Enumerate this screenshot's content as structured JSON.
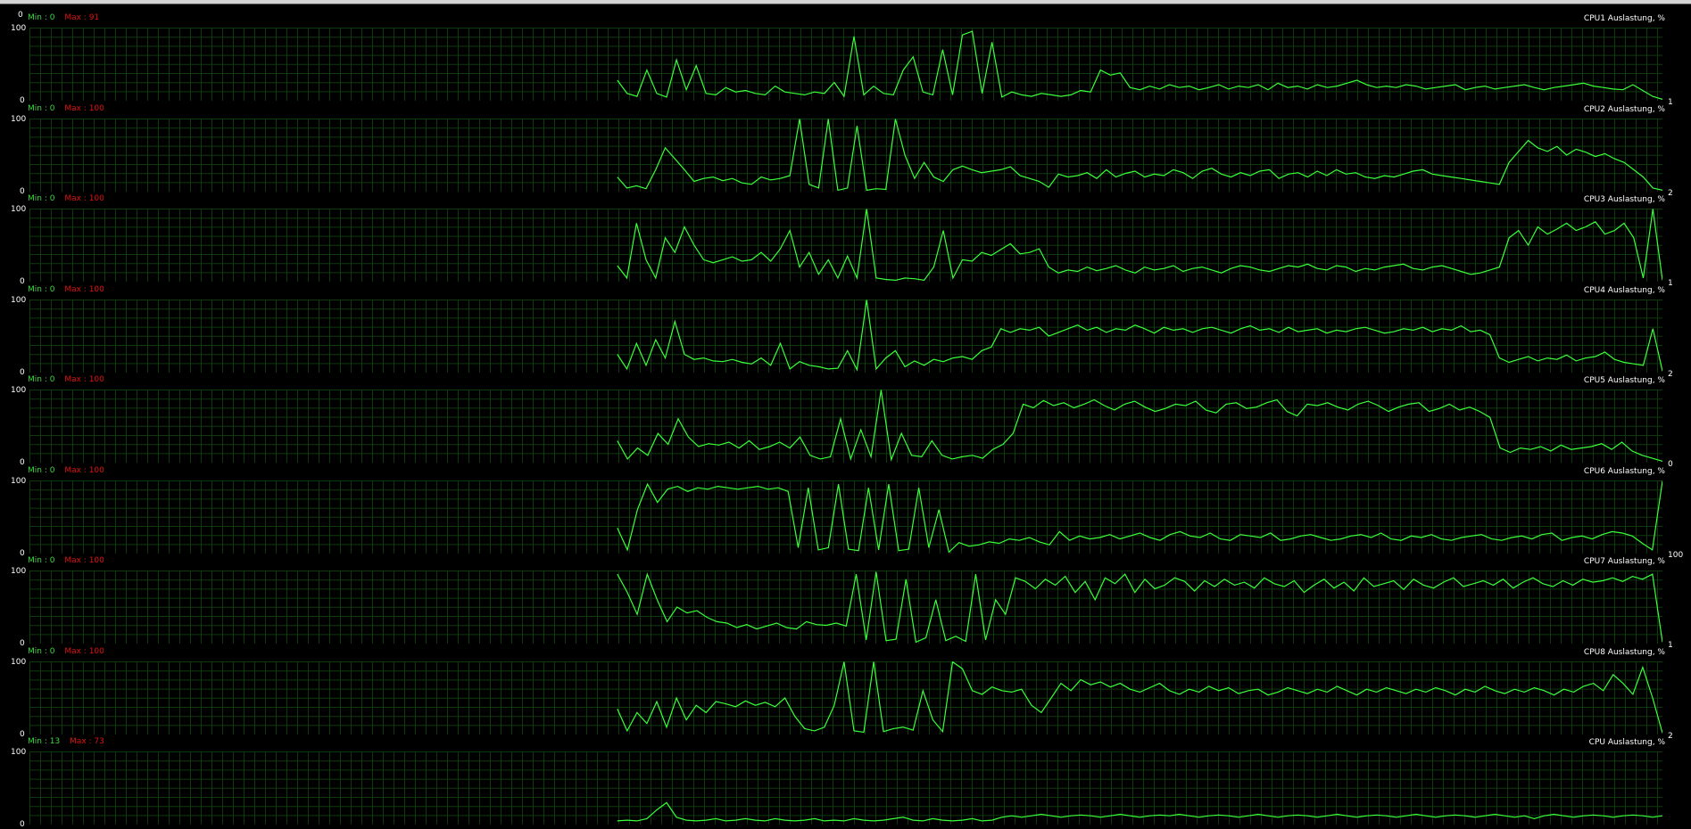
{
  "header": {
    "top_scale_label": "0"
  },
  "labels": {
    "min_prefix": "Min : ",
    "max_prefix": "Max : ",
    "y_max": "100",
    "y_min": "0"
  },
  "colors": {
    "background": "#000000",
    "grid": "#0e3a0e",
    "line": "#3aff3a",
    "min_text": "#3fd93f",
    "max_text": "#e01010"
  },
  "graphs": [
    {
      "title": "CPU1 Auslastung, %",
      "min": "0",
      "max": "91",
      "current": "1"
    },
    {
      "title": "CPU2 Auslastung, %",
      "min": "0",
      "max": "100",
      "current": "2"
    },
    {
      "title": "CPU3 Auslastung, %",
      "min": "0",
      "max": "100",
      "current": "1"
    },
    {
      "title": "CPU4 Auslastung, %",
      "min": "0",
      "max": "100",
      "current": "2"
    },
    {
      "title": "CPU5 Auslastung, %",
      "min": "0",
      "max": "100",
      "current": "0"
    },
    {
      "title": "CPU6 Auslastung, %",
      "min": "0",
      "max": "100",
      "current": "100"
    },
    {
      "title": "CPU7 Auslastung, %",
      "min": "0",
      "max": "100",
      "current": "1"
    },
    {
      "title": "CPU8 Auslastung, %",
      "min": "0",
      "max": "100",
      "current": "2"
    },
    {
      "title": "CPU Auslastung, %",
      "min": "13",
      "max": "73",
      "current": ""
    }
  ],
  "chart_data": [
    {
      "type": "line",
      "title": "CPU1 Auslastung, %",
      "ylim": [
        0,
        100
      ],
      "x_start": 0.36,
      "series": [
        {
          "values": [
            28,
            10,
            6,
            42,
            10,
            5,
            56,
            15,
            48,
            10,
            8,
            18,
            12,
            14,
            10,
            8,
            20,
            12,
            10,
            8,
            12,
            10,
            25,
            6,
            88,
            8,
            20,
            10,
            8,
            42,
            60,
            12,
            8,
            70,
            8,
            90,
            95,
            10,
            80,
            5,
            12,
            8,
            6,
            10,
            8,
            6,
            8,
            14,
            12,
            42,
            35,
            38,
            18,
            15,
            20,
            16,
            22,
            18,
            20,
            15,
            18,
            22,
            16,
            20,
            18,
            22,
            15,
            24,
            18,
            20,
            16,
            22,
            18,
            20,
            24,
            28,
            22,
            18,
            20,
            18,
            22,
            20,
            16,
            18,
            20,
            22,
            15,
            18,
            20,
            16,
            18,
            20,
            22,
            18,
            15,
            18,
            20,
            22,
            24,
            20,
            18,
            16,
            15,
            22,
            14,
            6,
            2
          ]
        }
      ]
    },
    {
      "type": "line",
      "title": "CPU2 Auslastung, %",
      "ylim": [
        0,
        100
      ],
      "x_start": 0.36,
      "series": [
        {
          "values": [
            20,
            5,
            8,
            4,
            30,
            60,
            45,
            30,
            14,
            18,
            20,
            15,
            18,
            12,
            10,
            20,
            16,
            18,
            22,
            100,
            10,
            5,
            100,
            2,
            5,
            90,
            2,
            4,
            3,
            100,
            50,
            18,
            40,
            20,
            14,
            30,
            35,
            30,
            26,
            28,
            30,
            34,
            22,
            18,
            14,
            6,
            24,
            20,
            22,
            26,
            18,
            30,
            20,
            25,
            28,
            20,
            24,
            22,
            30,
            26,
            18,
            28,
            32,
            24,
            20,
            26,
            22,
            28,
            30,
            18,
            24,
            26,
            20,
            28,
            22,
            30,
            24,
            26,
            20,
            18,
            22,
            20,
            24,
            28,
            30,
            24,
            22,
            20,
            18,
            16,
            14,
            12,
            10,
            40,
            55,
            70,
            60,
            55,
            62,
            50,
            58,
            54,
            48,
            52,
            45,
            40,
            30,
            20,
            5,
            2
          ]
        }
      ]
    },
    {
      "type": "line",
      "title": "CPU3 Auslastung, %",
      "ylim": [
        0,
        100
      ],
      "x_start": 0.36,
      "series": [
        {
          "values": [
            22,
            5,
            80,
            30,
            5,
            60,
            40,
            75,
            50,
            30,
            26,
            30,
            34,
            28,
            30,
            40,
            28,
            45,
            70,
            20,
            40,
            10,
            30,
            5,
            35,
            5,
            100,
            5,
            3,
            2,
            5,
            4,
            2,
            20,
            70,
            5,
            30,
            28,
            40,
            36,
            44,
            52,
            38,
            40,
            45,
            20,
            12,
            16,
            14,
            20,
            15,
            18,
            22,
            16,
            12,
            20,
            16,
            18,
            22,
            14,
            18,
            20,
            16,
            12,
            18,
            22,
            20,
            16,
            14,
            18,
            22,
            20,
            24,
            18,
            16,
            22,
            20,
            14,
            18,
            16,
            20,
            22,
            24,
            18,
            16,
            20,
            22,
            18,
            14,
            10,
            12,
            16,
            20,
            60,
            70,
            50,
            75,
            65,
            72,
            80,
            70,
            75,
            82,
            65,
            70,
            80,
            60,
            5,
            100,
            2
          ]
        }
      ]
    },
    {
      "type": "line",
      "title": "CPU4 Auslastung, %",
      "ylim": [
        0,
        100
      ],
      "x_start": 0.36,
      "series": [
        {
          "values": [
            25,
            5,
            40,
            10,
            45,
            20,
            70,
            25,
            18,
            20,
            16,
            15,
            18,
            14,
            12,
            20,
            10,
            40,
            5,
            15,
            10,
            8,
            5,
            6,
            30,
            4,
            100,
            5,
            20,
            30,
            8,
            16,
            10,
            18,
            15,
            20,
            22,
            18,
            30,
            35,
            60,
            55,
            60,
            58,
            62,
            50,
            55,
            60,
            65,
            58,
            62,
            55,
            60,
            58,
            65,
            60,
            54,
            62,
            58,
            60,
            55,
            60,
            62,
            58,
            54,
            60,
            64,
            58,
            60,
            55,
            62,
            56,
            58,
            60,
            54,
            58,
            56,
            60,
            62,
            58,
            54,
            56,
            60,
            58,
            62,
            56,
            60,
            58,
            64,
            56,
            58,
            52,
            20,
            14,
            18,
            22,
            16,
            20,
            18,
            24,
            16,
            20,
            22,
            28,
            18,
            14,
            12,
            10,
            60,
            2
          ]
        }
      ]
    },
    {
      "type": "line",
      "title": "CPU5 Auslastung, %",
      "ylim": [
        0,
        100
      ],
      "x_start": 0.36,
      "series": [
        {
          "values": [
            30,
            5,
            20,
            10,
            40,
            25,
            60,
            35,
            22,
            26,
            24,
            28,
            20,
            30,
            18,
            22,
            28,
            20,
            35,
            10,
            5,
            8,
            60,
            5,
            45,
            8,
            100,
            4,
            40,
            10,
            8,
            30,
            10,
            5,
            8,
            10,
            6,
            18,
            25,
            40,
            80,
            75,
            85,
            78,
            82,
            75,
            80,
            86,
            78,
            72,
            80,
            84,
            76,
            70,
            74,
            80,
            78,
            84,
            72,
            68,
            80,
            82,
            74,
            76,
            82,
            86,
            70,
            64,
            80,
            78,
            82,
            76,
            72,
            80,
            84,
            78,
            70,
            76,
            80,
            82,
            70,
            74,
            80,
            72,
            76,
            70,
            62,
            20,
            14,
            20,
            18,
            22,
            16,
            24,
            18,
            20,
            22,
            26,
            18,
            28,
            16,
            10,
            6,
            2
          ]
        }
      ]
    },
    {
      "type": "line",
      "title": "CPU6 Auslastung, %",
      "ylim": [
        0,
        100
      ],
      "x_start": 0.36,
      "series": [
        {
          "values": [
            35,
            5,
            60,
            95,
            70,
            88,
            92,
            85,
            90,
            88,
            92,
            90,
            88,
            90,
            92,
            88,
            90,
            85,
            8,
            90,
            5,
            8,
            95,
            6,
            4,
            90,
            5,
            95,
            4,
            6,
            90,
            8,
            60,
            2,
            15,
            10,
            12,
            16,
            14,
            20,
            18,
            22,
            16,
            12,
            30,
            18,
            24,
            20,
            22,
            26,
            20,
            24,
            28,
            22,
            18,
            26,
            30,
            24,
            22,
            28,
            20,
            18,
            26,
            24,
            22,
            28,
            18,
            20,
            24,
            26,
            22,
            18,
            20,
            24,
            26,
            22,
            28,
            20,
            18,
            24,
            22,
            26,
            20,
            18,
            22,
            24,
            26,
            20,
            18,
            22,
            24,
            20,
            26,
            28,
            18,
            22,
            24,
            20,
            26,
            30,
            28,
            24,
            14,
            5,
            100
          ]
        }
      ]
    },
    {
      "type": "line",
      "title": "CPU7 Auslastung, %",
      "ylim": [
        0,
        100
      ],
      "x_start": 0.36,
      "series": [
        {
          "values": [
            95,
            70,
            40,
            95,
            60,
            30,
            50,
            42,
            45,
            36,
            30,
            28,
            22,
            26,
            20,
            24,
            28,
            22,
            20,
            30,
            26,
            25,
            28,
            24,
            95,
            5,
            98,
            4,
            6,
            88,
            2,
            8,
            60,
            4,
            10,
            3,
            95,
            5,
            60,
            40,
            90,
            85,
            75,
            88,
            80,
            92,
            70,
            85,
            60,
            90,
            82,
            95,
            70,
            88,
            75,
            80,
            90,
            85,
            72,
            86,
            78,
            88,
            80,
            84,
            76,
            90,
            82,
            78,
            86,
            70,
            80,
            88,
            76,
            84,
            72,
            90,
            78,
            82,
            86,
            74,
            88,
            80,
            76,
            84,
            90,
            78,
            82,
            86,
            80,
            88,
            76,
            84,
            90,
            82,
            78,
            86,
            80,
            88,
            84,
            86,
            90,
            85,
            92,
            88,
            95,
            2
          ]
        }
      ]
    },
    {
      "type": "line",
      "title": "CPU8 Auslastung, %",
      "ylim": [
        0,
        100
      ],
      "x_start": 0.36,
      "series": [
        {
          "values": [
            35,
            5,
            30,
            15,
            45,
            10,
            50,
            20,
            40,
            30,
            45,
            42,
            38,
            46,
            40,
            44,
            38,
            50,
            25,
            8,
            5,
            10,
            40,
            100,
            5,
            3,
            100,
            4,
            8,
            10,
            6,
            60,
            20,
            4,
            100,
            90,
            60,
            55,
            65,
            60,
            58,
            62,
            40,
            30,
            50,
            70,
            60,
            75,
            68,
            72,
            65,
            70,
            62,
            58,
            64,
            70,
            60,
            55,
            62,
            58,
            66,
            60,
            64,
            56,
            60,
            62,
            54,
            58,
            64,
            60,
            56,
            62,
            58,
            66,
            60,
            54,
            62,
            58,
            64,
            60,
            56,
            62,
            58,
            64,
            60,
            54,
            62,
            58,
            66,
            60,
            56,
            62,
            58,
            64,
            60,
            54,
            62,
            58,
            66,
            70,
            60,
            82,
            70,
            55,
            92,
            50,
            2
          ]
        }
      ]
    },
    {
      "type": "line",
      "title": "CPU Auslastung, %",
      "ylim": [
        0,
        100
      ],
      "x_start": 0.36,
      "series": [
        {
          "values": [
            5,
            6,
            5,
            8,
            20,
            30,
            10,
            6,
            5,
            6,
            8,
            5,
            6,
            8,
            6,
            5,
            8,
            6,
            5,
            6,
            8,
            5,
            6,
            5,
            8,
            6,
            5,
            6,
            8,
            10,
            6,
            5,
            8,
            6,
            5,
            6,
            8,
            5,
            6,
            10,
            12,
            10,
            12,
            14,
            12,
            10,
            12,
            13,
            12,
            10,
            12,
            14,
            12,
            10,
            12,
            13,
            12,
            14,
            12,
            10,
            12,
            13,
            12,
            10,
            12,
            14,
            12,
            10,
            12,
            13,
            12,
            10,
            12,
            14,
            12,
            10,
            12,
            13,
            12,
            10,
            12,
            14,
            12,
            10,
            12,
            13,
            12,
            10,
            12,
            14,
            12,
            10,
            12,
            8,
            12,
            14,
            12,
            10,
            12,
            13,
            12,
            10,
            12,
            13,
            12,
            10,
            12
          ]
        }
      ]
    }
  ]
}
